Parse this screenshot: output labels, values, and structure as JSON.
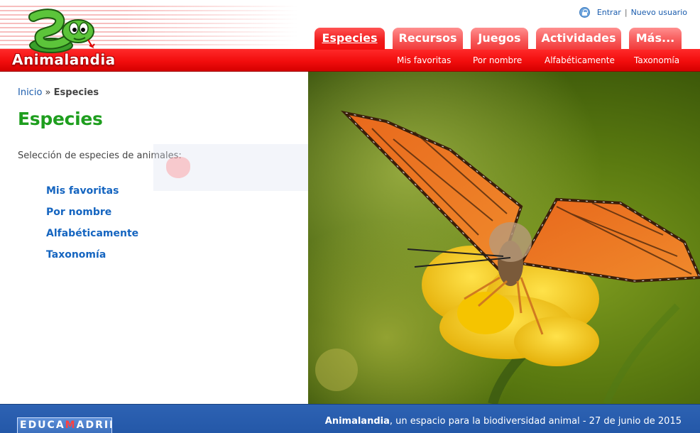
{
  "header": {
    "logo_text": "Animalandia",
    "login": {
      "enter": "Entrar",
      "separator": "|",
      "new_user": "Nuevo usuario"
    }
  },
  "tabs": [
    {
      "label": "Especies",
      "active": true
    },
    {
      "label": "Recursos",
      "active": false
    },
    {
      "label": "Juegos",
      "active": false
    },
    {
      "label": "Actividades",
      "active": false
    },
    {
      "label": "Más...",
      "active": false
    }
  ],
  "subnav": [
    "Mis favoritas",
    "Por nombre",
    "Alfabéticamente",
    "Taxonomía"
  ],
  "breadcrumb": {
    "home": "Inicio",
    "separator": "»",
    "current": "Especies"
  },
  "page": {
    "title": "Especies",
    "intro": "Selección de especies de animales:",
    "links": [
      "Mis favoritas",
      "Por nombre",
      "Alfabéticamente",
      "Taxonomía"
    ]
  },
  "footer": {
    "logo_text_a": "EDUCA",
    "logo_text_m": "M",
    "logo_text_b": "ADRID",
    "site_name": "Animalandia",
    "tagline": ", un espacio para la biodiversidad animal - 27 de junio de 2015"
  },
  "colors": {
    "header_red": "#f20d0d",
    "title_green": "#1e9e1e",
    "link_blue": "#1565c0",
    "footer_blue": "#2458a8"
  },
  "icons": [
    "logo-snake-icon",
    "lock-icon"
  ]
}
